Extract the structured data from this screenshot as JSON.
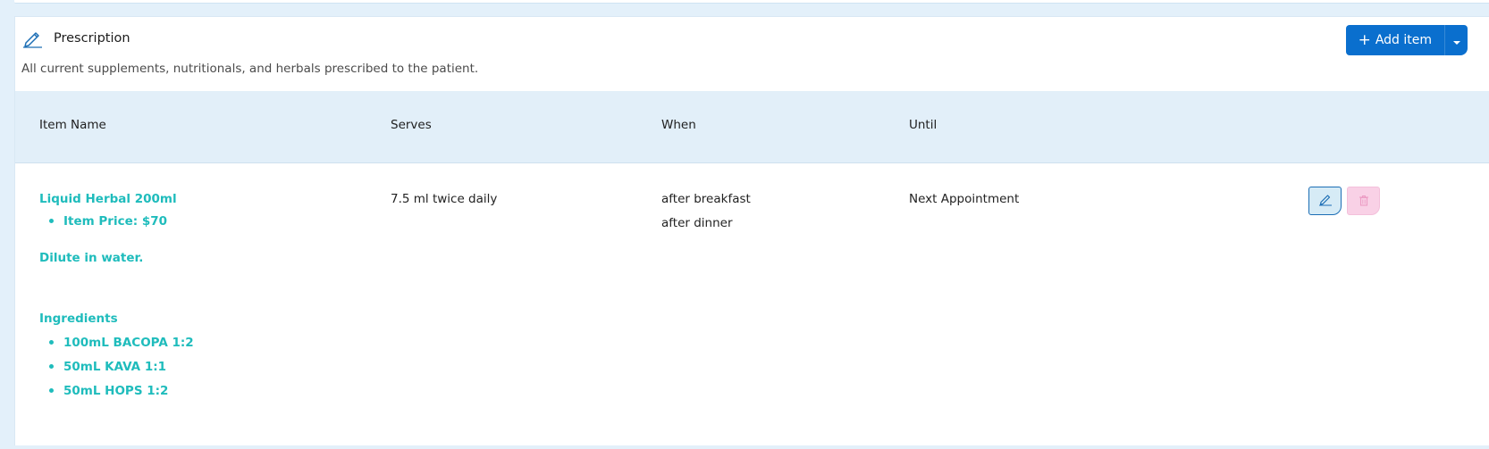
{
  "section": {
    "title": "Prescription",
    "subtitle": "All current supplements, nutritionals, and herbals prescribed to the patient."
  },
  "toolbar": {
    "add_label": "Add item"
  },
  "table": {
    "columns": [
      "Item Name",
      "Serves",
      "When",
      "Until"
    ],
    "rows": [
      {
        "item_name": "Liquid Herbal 200ml",
        "item_details": [
          "Item Price: $70"
        ],
        "note": "Dilute in water.",
        "ingredients_heading": "Ingredients",
        "ingredients": [
          "100mL BACOPA 1:2",
          "50mL KAVA 1:1",
          "50mL HOPS 1:2"
        ],
        "serves": "7.5 ml twice daily",
        "when": [
          "after breakfast",
          "after dinner"
        ],
        "until": "Next Appointment"
      }
    ]
  },
  "icons": {
    "title": "pen-icon",
    "edit": "pen-icon",
    "delete": "trash-icon",
    "add": "plus-icon",
    "dropdown": "caret-down-icon"
  },
  "colors": {
    "accent": "#0a6fce",
    "item_text": "#1fbcbc",
    "header_bg": "#e2eff9",
    "delete_bg": "#f9d1e6"
  }
}
